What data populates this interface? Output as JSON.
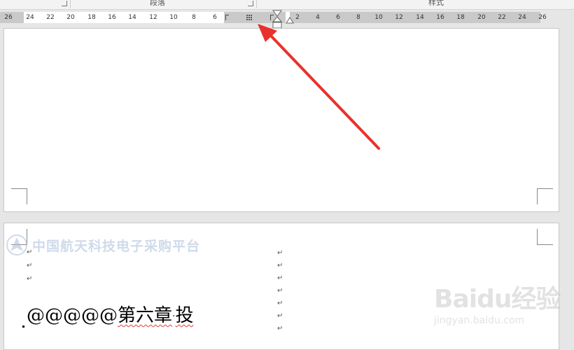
{
  "ribbon": {
    "groups": [
      {
        "label": "段落",
        "launcher": "dialog-launcher-icon"
      },
      {
        "label": "样式",
        "launcher": ""
      }
    ]
  },
  "ruler": {
    "left_numbers": [
      "26",
      "24",
      "22",
      "20",
      "18",
      "16",
      "14",
      "12",
      "10",
      "8",
      "6"
    ],
    "right_numbers": [
      "2",
      "4",
      "6",
      "8",
      "10",
      "12",
      "14",
      "16",
      "18",
      "20",
      "22",
      "24",
      "26"
    ],
    "markers": [
      "tab-stop-icon",
      "column-marker-icon",
      "hanging-indent-icon",
      "first-line-indent-icon",
      "right-indent-icon"
    ]
  },
  "document": {
    "watermark": "中国航天科技电子采购平台",
    "paragraph_mark": "↵",
    "heading": {
      "prefix": "@@@@@",
      "squiggle_text": "第六章",
      "dot": "·",
      "suffix": "投"
    }
  },
  "overlay": {
    "baidu_logo": "Baidu经验",
    "baidu_url": "jingyan.baidu.com"
  },
  "colors": {
    "arrow": "#e8322b",
    "background": "#e6e6e6",
    "ruler_gray": "#c9c9c9",
    "watermark": "#a9bcd9",
    "spellcheck": "#e23b3b"
  }
}
